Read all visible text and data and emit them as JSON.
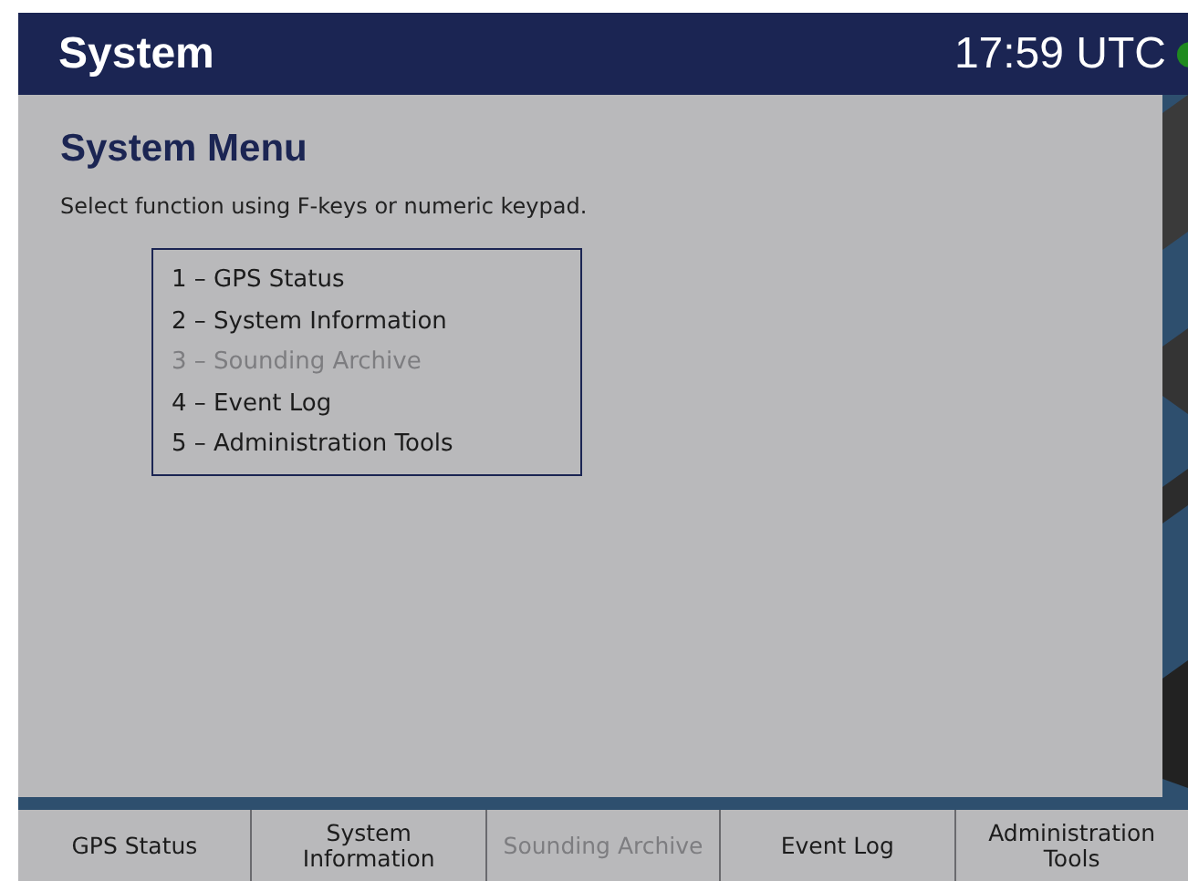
{
  "header": {
    "title": "System",
    "time": "17:59 UTC"
  },
  "page": {
    "title": "System Menu",
    "instruction": "Select function using F-keys or numeric keypad."
  },
  "menu_items": [
    {
      "label": "1 – GPS Status",
      "disabled": false
    },
    {
      "label": "2 – System Information",
      "disabled": false
    },
    {
      "label": "3 – Sounding Archive",
      "disabled": true
    },
    {
      "label": "4 – Event Log",
      "disabled": false
    },
    {
      "label": "5 – Administration Tools",
      "disabled": false
    }
  ],
  "function_keys": [
    {
      "label": "GPS Status",
      "disabled": false
    },
    {
      "label": "System Information",
      "disabled": false
    },
    {
      "label": "Sounding Archive",
      "disabled": true
    },
    {
      "label": "Event Log",
      "disabled": false
    },
    {
      "label": "Administration Tools",
      "disabled": false
    }
  ]
}
